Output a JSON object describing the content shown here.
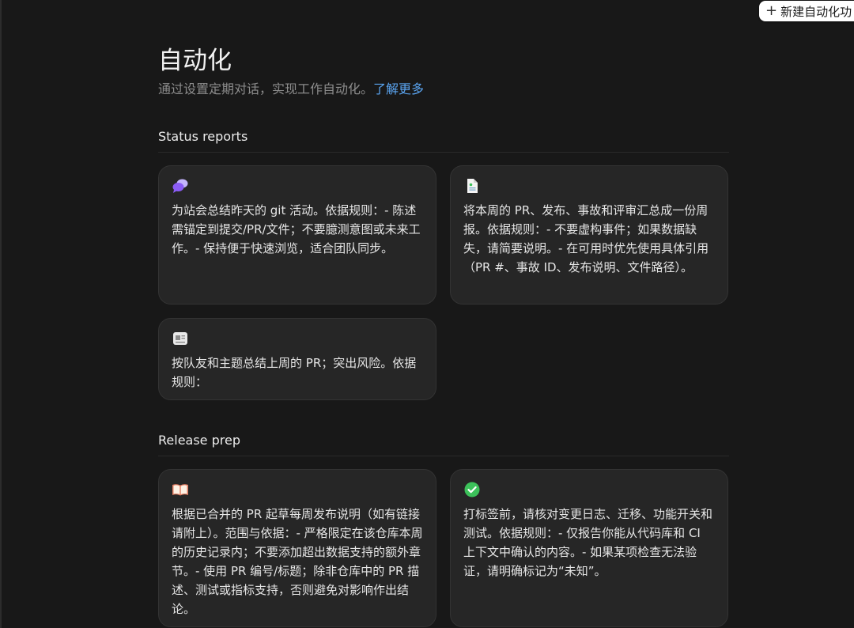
{
  "header": {
    "new_button_label": "新建自动化功"
  },
  "page": {
    "title": "自动化",
    "subtitle": "通过设置定期对话，实现工作自动化。",
    "learn_more": "了解更多"
  },
  "sections": [
    {
      "title": "Status reports",
      "cards": [
        {
          "icon": "chat-bubbles-icon",
          "text": "为站会总结昨天的 git 活动。依据规则：- 陈述需锚定到提交/PR/文件；不要臆测意图或未来工作。- 保持便于快速浏览，适合团队同步。"
        },
        {
          "icon": "document-icon",
          "text": "将本周的 PR、发布、事故和评审汇总成一份周报。依据规则：- 不要虚构事件；如果数据缺失，请简要说明。- 在可用时优先使用具体引用（PR #、事故 ID、发布说明、文件路径）。"
        },
        {
          "icon": "newspaper-icon",
          "text": "按队友和主题总结上周的 PR；突出风险。依据规则："
        }
      ]
    },
    {
      "title": "Release prep",
      "cards": [
        {
          "icon": "open-book-icon",
          "text": "根据已合并的 PR 起草每周发布说明（如有链接请附上）。范围与依据：- 严格限定在该仓库本周的历史记录内；不要添加超出数据支持的额外章节。- 使用 PR 编号/标题；除非仓库中的 PR 描述、测试或指标支持，否则避免对影响作出结论。"
        },
        {
          "icon": "check-circle-icon",
          "text": "打标签前，请核对变更日志、迁移、功能开关和测试。依据规则：- 仅报告你能从代码库和 CI 上下文中确认的内容。- 如果某项检查无法验证，请明确标记为“未知”。"
        }
      ]
    }
  ],
  "colors": {
    "background": "#181818",
    "card": "#262626",
    "link": "#5aa4f0",
    "check_green": "#3cc15a",
    "chat_purple": "#a78bfa"
  }
}
